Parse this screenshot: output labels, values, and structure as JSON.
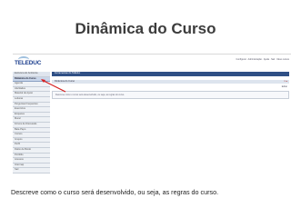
{
  "slide": {
    "title": "Dinâmica do Curso",
    "description": "Descreve como o curso será desenvolvido, ou seja, as regras do curso."
  },
  "app": {
    "logo": "TELEDUC",
    "top_links": "Configurar · Administração · Ajuda · Sair · Meus cursos",
    "main_bar": "Ferramentas do TelEduc",
    "sub_bar": "Dinâmica do Curso",
    "sub_bar_right": "x  ●",
    "content_text": "Descreve como o curso será desenvolvido, ou seja, as regras do curso.",
    "box_right": "Editar"
  },
  "sidebar": {
    "items": [
      {
        "label": "Estrutura do Ambiente",
        "active": false
      },
      {
        "label": "Dinâmica do Curso",
        "active": true
      },
      {
        "label": "Agenda",
        "active": false
      },
      {
        "label": "Atividades",
        "active": false
      },
      {
        "label": "Material de Apoio",
        "active": false
      },
      {
        "label": "Leituras",
        "active": false
      },
      {
        "label": "Perguntas Frequentes",
        "active": false
      },
      {
        "label": "Exercícios",
        "active": false
      },
      {
        "label": "Enquetes",
        "active": false
      },
      {
        "label": "Mural",
        "active": false
      },
      {
        "label": "Fóruns de Discussão",
        "active": false
      },
      {
        "label": "Bate-Papo",
        "active": false
      },
      {
        "label": "Correio",
        "active": false
      },
      {
        "label": "Grupos",
        "active": false
      },
      {
        "label": "Perfil",
        "active": false
      },
      {
        "label": "Diário de Bordo",
        "active": false
      },
      {
        "label": "Portfólio",
        "active": false
      },
      {
        "label": "Acessos",
        "active": false
      },
      {
        "label": "Intermap",
        "active": false
      },
      {
        "label": "Sair",
        "active": false
      }
    ]
  }
}
